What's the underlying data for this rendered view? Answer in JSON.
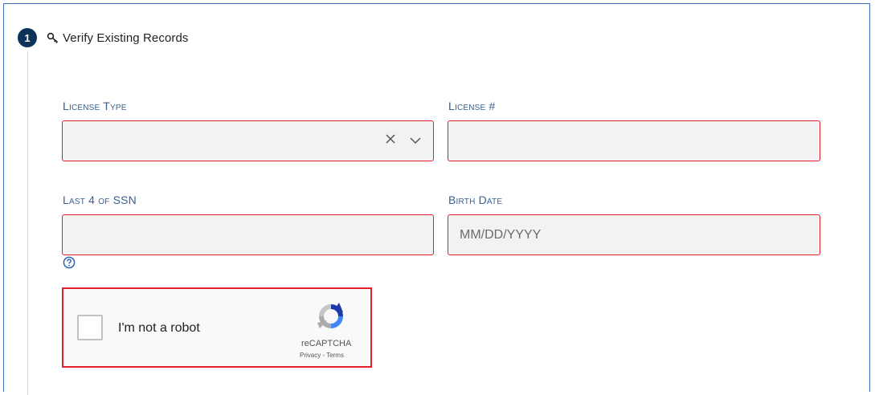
{
  "step": {
    "number": "1",
    "icon": "key-icon",
    "title": "Verify Existing Records"
  },
  "fields": {
    "license_type": {
      "label": "License Type",
      "value": "",
      "clear_icon": "close-icon",
      "dropdown_icon": "chevron-down-icon"
    },
    "license_number": {
      "label": "License #",
      "value": "",
      "placeholder": ""
    },
    "ssn_last4": {
      "label": "Last 4 of SSN",
      "value": "",
      "placeholder": "",
      "help_icon": "question-circle-icon"
    },
    "birth_date": {
      "label": "Birth Date",
      "value": "",
      "placeholder": "MM/DD/YYYY"
    }
  },
  "captcha": {
    "label": "I'm not a robot",
    "brand": "reCAPTCHA",
    "links": "Privacy - Terms",
    "checked": false
  },
  "colors": {
    "badge": "#0d3358",
    "label": "#3a5f8f",
    "error_border": "#e0202b",
    "field_bg": "#f2f2f2",
    "frame_border": "#3f6fb6"
  }
}
